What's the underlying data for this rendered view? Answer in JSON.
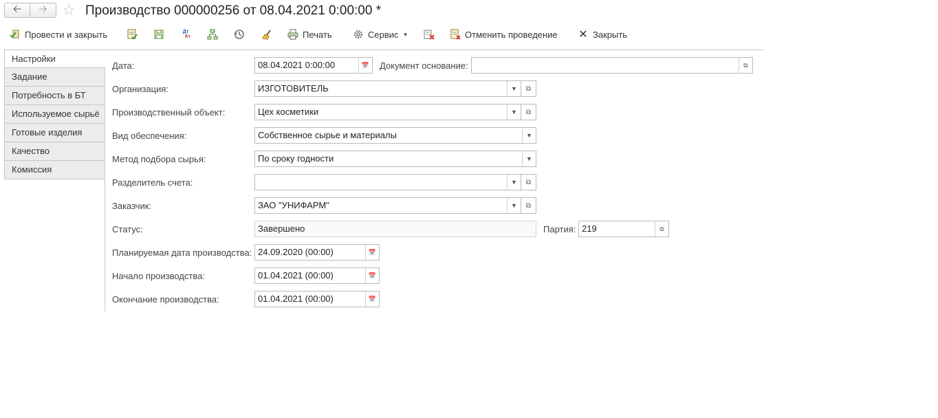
{
  "window": {
    "title": "Производство 000000256 от 08.04.2021 0:00:00 *"
  },
  "toolbar": {
    "post_close": "Провести и закрыть",
    "print": "Печать",
    "service": "Сервис",
    "cancel_posting": "Отменить проведение",
    "close": "Закрыть",
    "dt_kt_top": "Дт",
    "dt_kt_bottom": "Кт"
  },
  "tabs": [
    {
      "label": "Настройки",
      "active": true
    },
    {
      "label": "Задание"
    },
    {
      "label": "Потребность в БТ"
    },
    {
      "label": "Используемое сырьё"
    },
    {
      "label": "Готовые изделия"
    },
    {
      "label": "Качество"
    },
    {
      "label": "Комиссия"
    }
  ],
  "form": {
    "date": {
      "label": "Дата:",
      "value": "08.04.2021  0:00:00"
    },
    "base_doc": {
      "label": "Документ основание:",
      "value": ""
    },
    "organization": {
      "label": "Организация:",
      "value": "ИЗГОТОВИТЕЛЬ"
    },
    "prod_object": {
      "label": "Производственный объект:",
      "value": "Цех косметики"
    },
    "supply_type": {
      "label": "Вид обеспечения:",
      "value": "Собственное сырье и материалы"
    },
    "selection_method": {
      "label": "Метод подбора сырья:",
      "value": "По сроку годности"
    },
    "account_divider": {
      "label": "Разделитель счета:",
      "value": ""
    },
    "customer": {
      "label": "Заказчик:",
      "value": "ЗАО \"УНИФАРМ\""
    },
    "status": {
      "label": "Статус:",
      "value": "Завершено"
    },
    "batch": {
      "label": "Партия:",
      "value": "219"
    },
    "planned_date": {
      "label": "Планируемая дата производства:",
      "value": "24.09.2020 (00:00)"
    },
    "start": {
      "label": "Начало производства:",
      "value": "01.04.2021 (00:00)"
    },
    "end": {
      "label": "Окончание производства:",
      "value": "01.04.2021 (00:00)"
    }
  }
}
